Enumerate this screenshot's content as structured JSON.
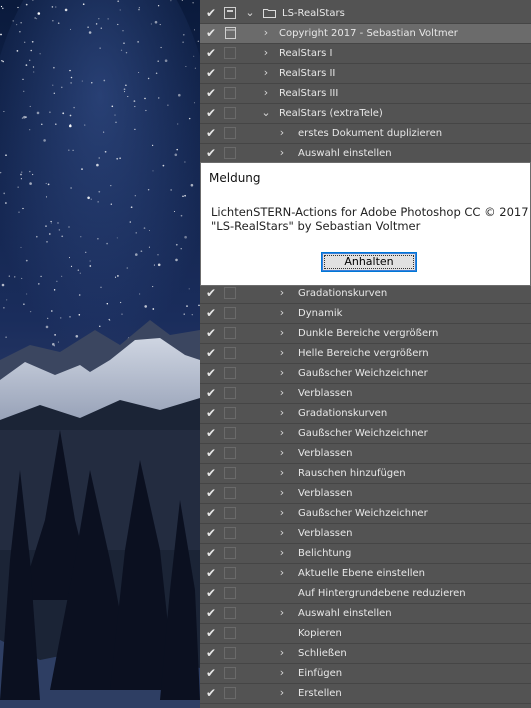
{
  "actions_panel": {
    "set_name": "LS-RealStars",
    "rows": [
      {
        "label": "Copyright 2017 - Sebastian Voltmer",
        "selected": true
      },
      {
        "label": "RealStars I"
      },
      {
        "label": "RealStars II"
      },
      {
        "label": "RealStars III"
      },
      {
        "label": "RealStars (extraTele)"
      },
      {
        "label": "erstes Dokument duplizieren"
      },
      {
        "label": "Auswahl einstellen"
      },
      {
        "label": "Gradationskurven"
      },
      {
        "label": "Dynamik"
      },
      {
        "label": "Dunkle Bereiche vergrößern"
      },
      {
        "label": "Helle Bereiche vergrößern"
      },
      {
        "label": "Gaußscher Weichzeichner"
      },
      {
        "label": "Verblassen"
      },
      {
        "label": "Gradationskurven"
      },
      {
        "label": "Gaußscher Weichzeichner"
      },
      {
        "label": "Verblassen"
      },
      {
        "label": "Rauschen hinzufügen"
      },
      {
        "label": "Verblassen"
      },
      {
        "label": "Gaußscher Weichzeichner"
      },
      {
        "label": "Verblassen"
      },
      {
        "label": "Belichtung"
      },
      {
        "label": "Aktuelle Ebene einstellen"
      },
      {
        "label": "Auf Hintergrundebene reduzieren"
      },
      {
        "label": "Auswahl einstellen"
      },
      {
        "label": "Kopieren"
      },
      {
        "label": "Schließen"
      },
      {
        "label": "Einfügen"
      },
      {
        "label": "Erstellen"
      }
    ]
  },
  "dialog": {
    "title": "Meldung",
    "message_line1": "LichtenSTERN-Actions for Adobe Photoshop CC © 2017",
    "message_line2": "\"LS-RealStars\" by Sebastian Voltmer",
    "button_label": "Anhalten"
  }
}
